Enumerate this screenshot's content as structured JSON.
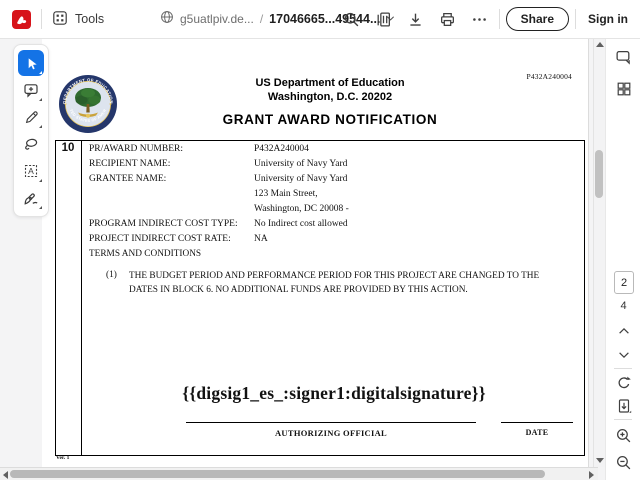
{
  "topbar": {
    "tools_label": "Tools",
    "breadcrumb": {
      "site": "g5uatlpiv.de...",
      "separator": "/",
      "file": "17046665...49544..."
    },
    "share_label": "Share",
    "sign_in_label": "Sign in"
  },
  "right_panel": {
    "current_page": "2",
    "total_pages": "4"
  },
  "document": {
    "corner_award_number": "P432A240004",
    "agency_name": "US Department of Education",
    "agency_address": "Washington, D.C. 20202",
    "title": "GRANT AWARD NOTIFICATION",
    "block_number": "10",
    "seal": {
      "top_text": "DEPARTMENT OF EDUCATION",
      "bottom_text": "UNITED STATES OF AMERICA"
    },
    "fields": [
      {
        "label": "PR/AWARD NUMBER:",
        "value": "P432A240004"
      },
      {
        "label": "RECIPIENT NAME:",
        "value": "University of Navy Yard"
      },
      {
        "label": "GRANTEE NAME:",
        "value": "University of Navy Yard"
      },
      {
        "label": "",
        "value": "123 Main Street,"
      },
      {
        "label": "",
        "value": "Washington, DC 20008 -"
      },
      {
        "label": "PROGRAM INDIRECT COST TYPE:",
        "value": "No Indirect cost allowed"
      },
      {
        "label": "PROJECT INDIRECT COST RATE:",
        "value": "NA"
      }
    ],
    "terms_heading": "TERMS AND CONDITIONS",
    "terms_item_number": "(1)",
    "terms_item_text": "THE BUDGET PERIOD AND PERFORMANCE PERIOD FOR THIS PROJECT ARE CHANGED TO THE DATES IN BLOCK 6. NO ADDITIONAL FUNDS ARE PROVIDED BY THIS ACTION.",
    "signature_placeholder": "{{digsig1_es_:signer1:digitalsignature}}",
    "authorizing_official_label": "AUTHORIZING OFFICIAL",
    "date_label": "DATE",
    "version_label": "Ver. 1"
  },
  "icons": {
    "more_glyph": "•••",
    "text_box_glyph": "A"
  },
  "colors": {
    "accent_blue": "#1473e6",
    "acrobat_red": "#d7141a",
    "seal_navy": "#25376b",
    "seal_green": "#2f6b2f"
  }
}
